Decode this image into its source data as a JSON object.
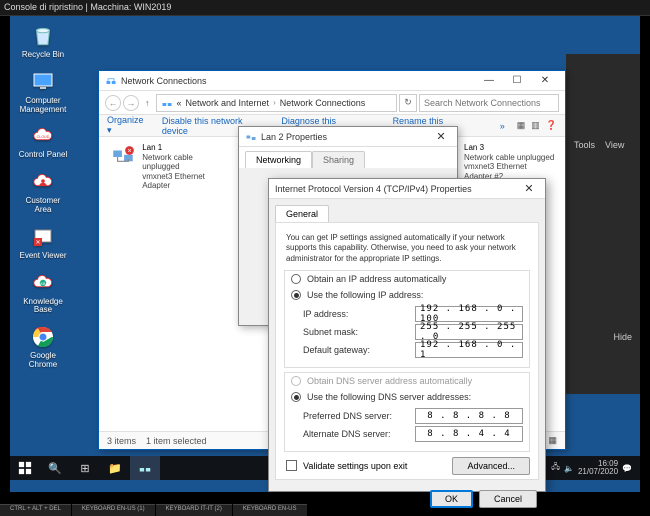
{
  "console": {
    "title": "Console di ripristino  |  Macchina: WIN2019"
  },
  "desktop": {
    "icons": [
      {
        "name": "recycle-bin",
        "label": "Recycle Bin"
      },
      {
        "name": "computer-management",
        "label": "Computer\nManagement"
      },
      {
        "name": "control-panel",
        "label": "Control Panel"
      },
      {
        "name": "customer-area",
        "label": "Customer\nArea"
      },
      {
        "name": "event-viewer",
        "label": "Event Viewer"
      },
      {
        "name": "knowledge-base",
        "label": "Knowledge\nBase"
      },
      {
        "name": "google-chrome",
        "label": "Google\nChrome"
      }
    ]
  },
  "explorer": {
    "title": "Network Connections",
    "breadcrumb": {
      "up": "↑",
      "parts": [
        "«",
        "Network and Internet",
        "Network Connections"
      ],
      "search_placeholder": "Search Network Connections"
    },
    "toolbar": {
      "organize": "Organize ▾",
      "disable": "Disable this network device",
      "diagnose": "Diagnose this connection",
      "rename": "Rename this connection",
      "more": "»"
    },
    "items": [
      {
        "name": "Lan 1",
        "line1": "Network cable unplugged",
        "line2": "vmxnet3 Ethernet Adapter"
      },
      {
        "name": "Lan 3",
        "line1": "Network cable unplugged",
        "line2": "vmxnet3 Ethernet Adapter #2"
      }
    ],
    "status": {
      "count": "3 items",
      "sel": "1 item selected"
    }
  },
  "vmpanel": {
    "tools": "Tools",
    "view": "View",
    "hide": "Hide"
  },
  "lanprops": {
    "title": "Lan 2 Properties",
    "tabs": {
      "net": "Networking",
      "share": "Sharing"
    }
  },
  "ipv4": {
    "title": "Internet Protocol Version 4 (TCP/IPv4) Properties",
    "tab": "General",
    "note": "You can get IP settings assigned automatically if your network supports this capability. Otherwise, you need to ask your network administrator for the appropriate IP settings.",
    "radios": {
      "ip_auto": "Obtain an IP address automatically",
      "ip_manual": "Use the following IP address:",
      "dns_auto": "Obtain DNS server address automatically",
      "dns_manual": "Use the following DNS server addresses:"
    },
    "fields": {
      "ip_label": "IP address:",
      "ip": "192 . 168 .  0  . 100",
      "mask_label": "Subnet mask:",
      "mask": "255 . 255 . 255 .  0",
      "gw_label": "Default gateway:",
      "gw": "192 . 168 .  0  .  1",
      "dns1_label": "Preferred DNS server:",
      "dns1": "8  .  8  .  8  .  8",
      "dns2_label": "Alternate DNS server:",
      "dns2": "8  .  8  .  4  .  4"
    },
    "validate": "Validate settings upon exit",
    "advanced": "Advanced...",
    "ok": "OK",
    "cancel": "Cancel"
  },
  "clock": {
    "time": "16:09",
    "date": "21/07/2020"
  }
}
